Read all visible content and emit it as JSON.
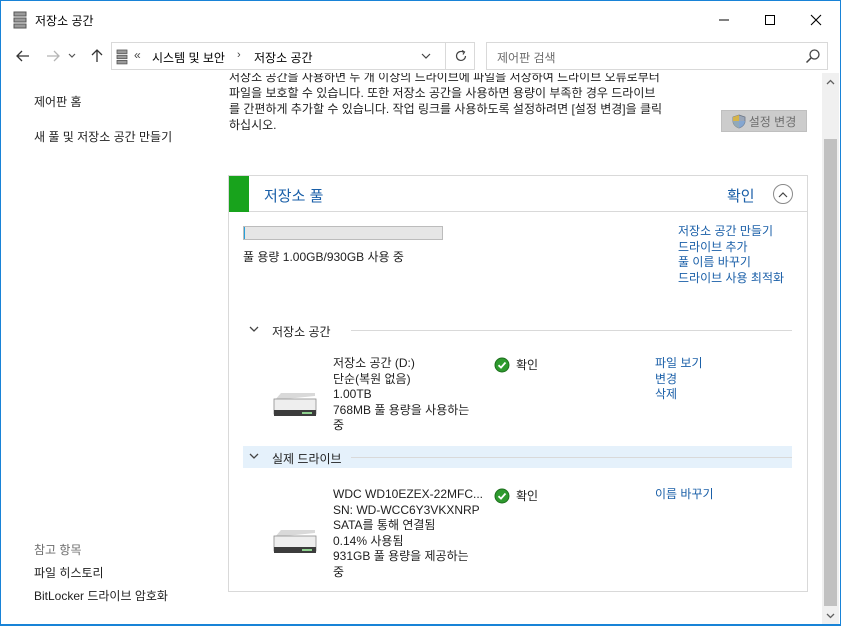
{
  "window": {
    "title": "저장소 공간",
    "minimize_icon": "minimize-icon",
    "maximize_icon": "maximize-icon",
    "close_icon": "close-icon"
  },
  "nav": {
    "breadcrumb_overflow": "«",
    "breadcrumb": [
      "시스템 및 보안",
      "저장소 공간"
    ],
    "search_placeholder": "제어판 검색"
  },
  "sidebar": {
    "links": [
      "제어판 홈",
      "새 풀 및 저장소 공간 만들기"
    ],
    "see_also_title": "참고 항목",
    "see_also": [
      "파일 히스토리",
      "BitLocker 드라이브 암호화"
    ]
  },
  "main": {
    "intro_lines": [
      "저장소 공간을 사용하면 두 개 이상의 드라이브에 파일을 저장하여 드라이브 오류로부터",
      "파일을 보호할 수 있습니다. 또한 저장소 공간을 사용하면 용량이 부족한 경우 드라이브",
      "를 간편하게 추가할 수 있습니다. 작업 링크를 사용하도록 설정하려면 [설정 변경]을 클릭",
      "하십시오."
    ],
    "change_settings_label": "설정 변경"
  },
  "pool": {
    "title": "저장소 풀",
    "status": "확인",
    "capacity_fraction": 0.0011,
    "capacity_text": "풀 용량 1.00GB/930GB 사용 중",
    "actions": [
      "저장소 공간 만들기",
      "드라이브 추가",
      "풀 이름 바꾸기",
      "드라이브 사용 최적화"
    ],
    "spaces_section": "저장소 공간",
    "spaces": [
      {
        "name": "저장소 공간 (D:)",
        "resiliency": "단순(복원 없음)",
        "size": "1.00TB",
        "usage": "768MB 풀 용량을 사용하는 중",
        "status": "확인",
        "actions": [
          "파일 보기",
          "변경",
          "삭제"
        ]
      }
    ],
    "drives_section": "실제 드라이브",
    "drives": [
      {
        "name": "WDC WD10EZEX-22MFC...",
        "serial": "SN: WD-WCC6Y3VKXNRP",
        "connection": "SATA를 통해 연결됨",
        "used": "0.14% 사용됨",
        "provides": "931GB 풀 용량을 제공하는 중",
        "status": "확인",
        "actions": [
          "이름 바꾸기"
        ]
      }
    ]
  },
  "colors": {
    "link": "#1a5fa8",
    "pool_ok_green": "#18a31c",
    "window_border": "#1883d7",
    "section_highlight": "#e5f1fb"
  }
}
